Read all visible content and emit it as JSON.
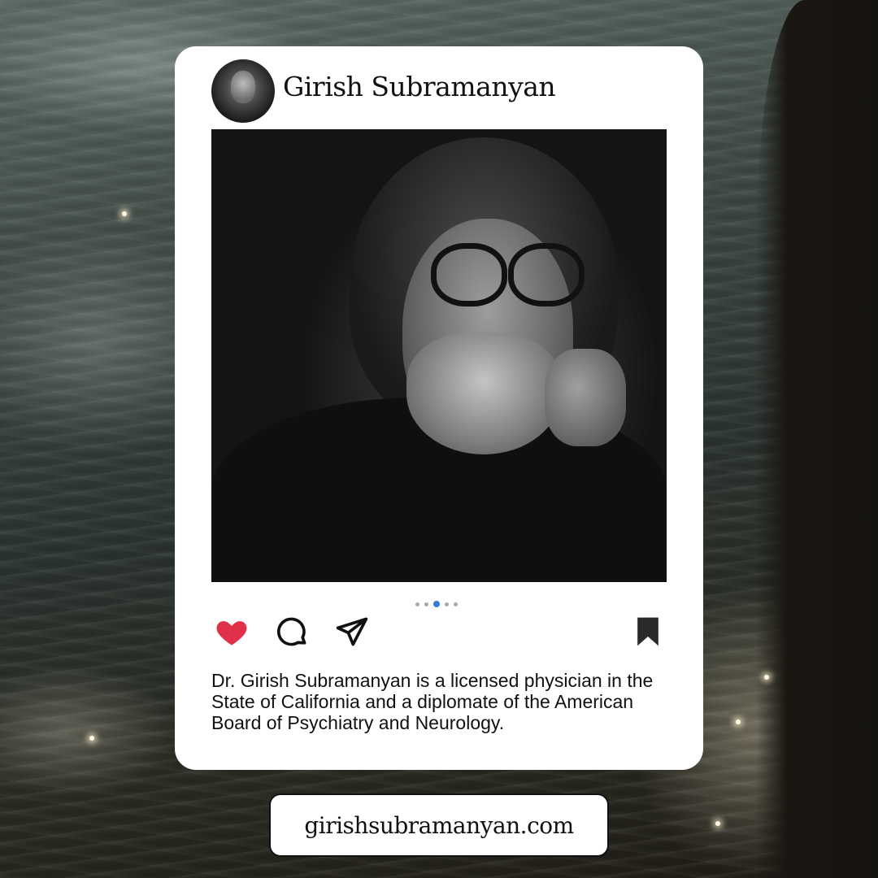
{
  "colors": {
    "like_red": "#e0304a",
    "dot_active": "#3a7bd5",
    "card_bg": "#ffffff"
  },
  "post": {
    "username": "Girish Subramanyan",
    "avatar_alt": "profile-photo",
    "carousel": {
      "total": 5,
      "active_index": 2
    },
    "actions": {
      "like_icon": "heart-icon",
      "comment_icon": "comment-bubble-icon",
      "share_icon": "send-icon",
      "save_icon": "bookmark-icon"
    },
    "caption": "Dr. Girish Subramanyan is a licensed physician in the State of California and a diplomate of the American Board of Psychiatry and Neurology."
  },
  "footer": {
    "website": "girishsubramanyan.com"
  }
}
